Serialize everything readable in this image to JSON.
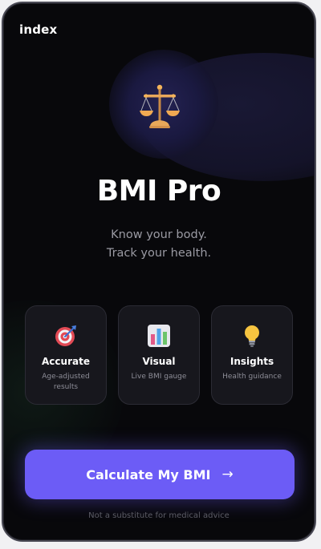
{
  "page": {
    "label": "index"
  },
  "hero": {
    "icon": "balance-scale-icon",
    "title": "BMI Pro",
    "tagline_line1": "Know your body.",
    "tagline_line2": "Track your health."
  },
  "features": [
    {
      "icon": "target-icon",
      "title": "Accurate",
      "description": "Age-adjusted results"
    },
    {
      "icon": "bar-chart-icon",
      "title": "Visual",
      "description": "Live BMI gauge"
    },
    {
      "icon": "lightbulb-icon",
      "title": "Insights",
      "description": "Health guidance"
    }
  ],
  "cta": {
    "label": "Calculate My BMI",
    "arrow": "→"
  },
  "footer": {
    "disclaimer": "Not a substitute for medical advice"
  },
  "colors": {
    "background": "#08080b",
    "card": "#17171d",
    "accent": "#6c5cf6",
    "text": "#ffffff",
    "muted": "#9a9aa3"
  }
}
